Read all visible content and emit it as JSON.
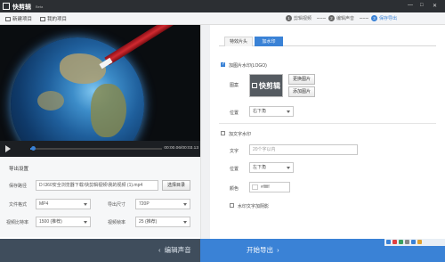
{
  "titlebar": {
    "app_name": "快剪辑",
    "badge": "Beta",
    "controls": [
      "—",
      "□",
      "✕"
    ]
  },
  "toolbar": {
    "new_project": "新建项目",
    "my_projects": "我的项目",
    "steps": [
      {
        "num": "1",
        "label": "剪辑视频"
      },
      {
        "num": "2",
        "label": "编辑声音"
      },
      {
        "num": "3",
        "label": "保存导出"
      }
    ]
  },
  "player": {
    "time": "00:00.06/00:03.13",
    "progress": 0.02
  },
  "export_settings": {
    "title": "导出设置",
    "path_label": "保存路径",
    "path_value": "D:\\360安全浏览器下载\\快剪辑视频\\我的视频 (1).mp4",
    "choose_dir": "选择目录",
    "format_label": "文件格式",
    "format_value": "MP4",
    "size_label": "导出尺寸",
    "size_value": "720P",
    "bitrate_label": "视频比特率",
    "bitrate_value": "1500 (推荐)",
    "framerate_label": "视频帧率",
    "framerate_value": "25 (推荐)"
  },
  "bottombar": {
    "prev": "编辑声音",
    "next": "开始导出"
  },
  "right": {
    "tabs": [
      "特效片头",
      "加水印"
    ],
    "image_watermark_label": "加图片水印(LOGO)",
    "image_label": "图案",
    "logo_text": "快剪辑",
    "replace_image": "更换图片",
    "add_image": "添加图片",
    "position_label": "位置",
    "position_value": "右下角",
    "text_watermark_label": "加文字水印",
    "text_label": "文字",
    "text_placeholder": "20个字以内",
    "text_position_label": "位置",
    "text_position_value": "左下角",
    "color_label": "颜色",
    "color_value": "#ffffff",
    "shadow_label": "水印文字加阴影"
  },
  "colors": {
    "accent": "#3a82d6",
    "titlebar": "#2c2f33",
    "bottombar": "#3f4d5c"
  }
}
